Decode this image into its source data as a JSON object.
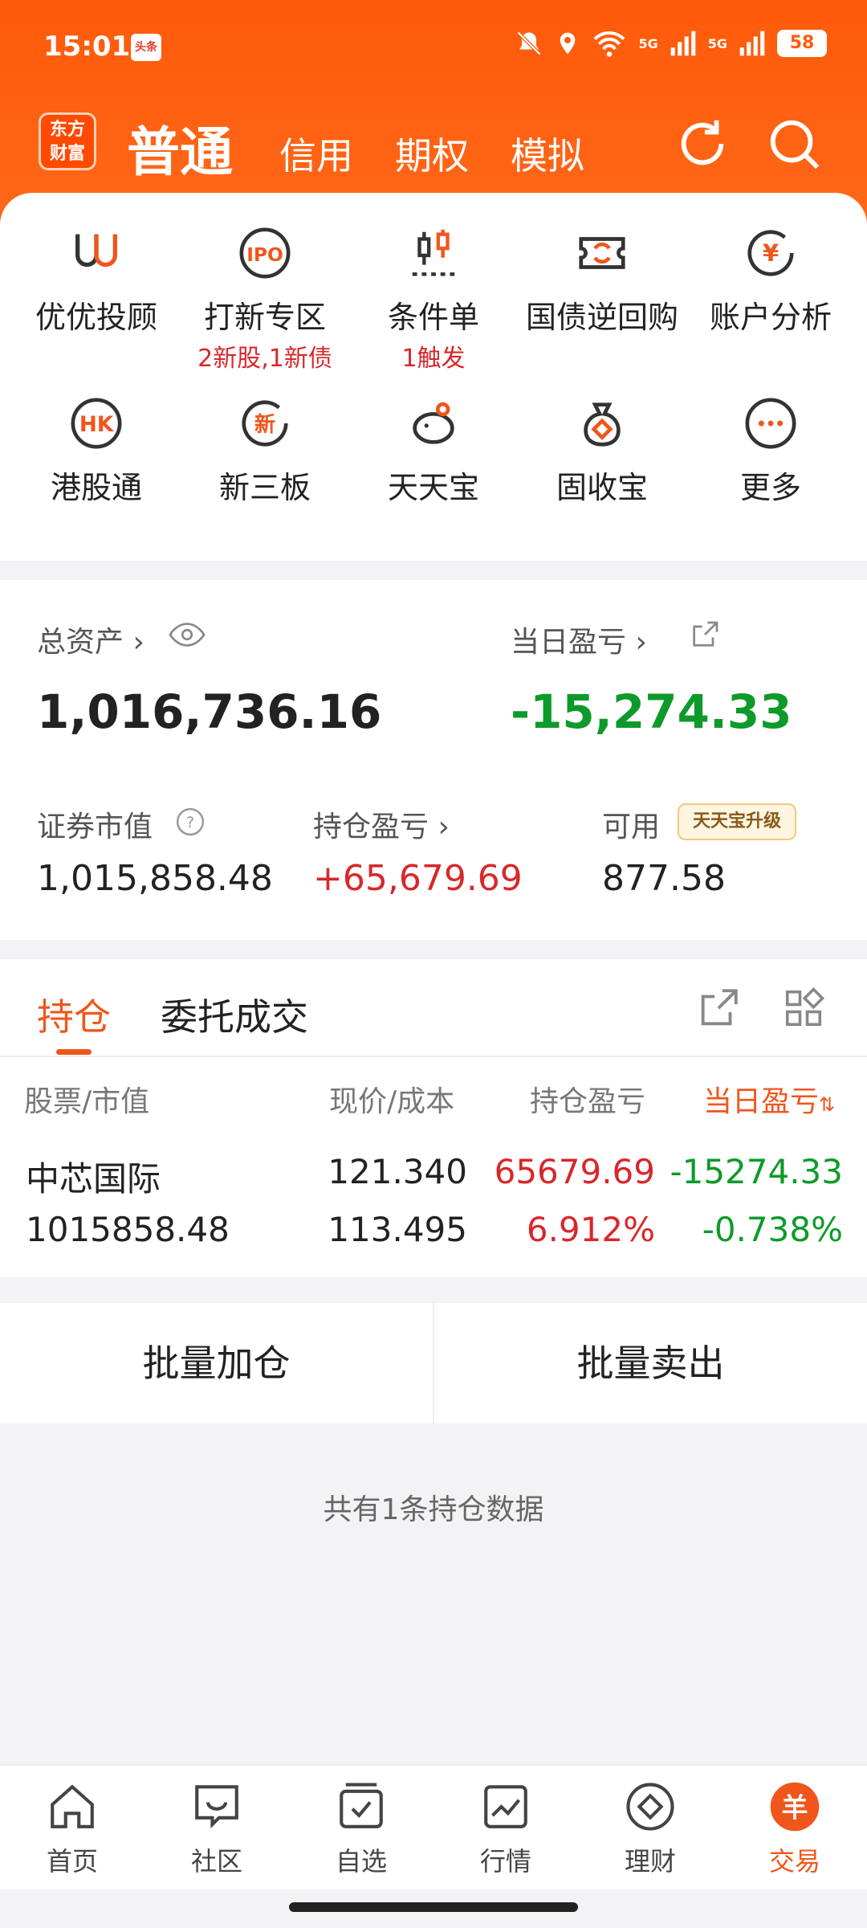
{
  "status_bar": {
    "time": "15:01",
    "news_badge": "头条",
    "signal1": "5G",
    "signal2": "5G",
    "battery": "58"
  },
  "top_nav": {
    "logo_line1": "东方",
    "logo_line2": "财富",
    "tabs": [
      {
        "label": "普通"
      },
      {
        "label": "信用"
      },
      {
        "label": "期权"
      },
      {
        "label": "模拟"
      }
    ]
  },
  "quick_menu": [
    {
      "label": "优优投顾",
      "sub": ""
    },
    {
      "label": "打新专区",
      "sub": "2新股,1新债",
      "icon_text": "IPO"
    },
    {
      "label": "条件单",
      "sub": "1触发"
    },
    {
      "label": "国债逆回购",
      "sub": ""
    },
    {
      "label": "账户分析",
      "sub": "",
      "icon_text": "¥"
    },
    {
      "label": "港股通",
      "sub": "",
      "icon_text": "HK"
    },
    {
      "label": "新三板",
      "sub": "",
      "icon_text": "新"
    },
    {
      "label": "天天宝",
      "sub": ""
    },
    {
      "label": "固收宝",
      "sub": ""
    },
    {
      "label": "更多",
      "sub": ""
    }
  ],
  "assets": {
    "total_label": "总资产",
    "total_value": "1,016,736.16",
    "daily_pl_label": "当日盈亏",
    "daily_pl_value": "-15,274.33",
    "market_value_label": "证券市值",
    "market_value": "1,015,858.48",
    "position_pl_label": "持仓盈亏",
    "position_pl_value": "+65,679.69",
    "available_label": "可用",
    "available_value": "877.58",
    "upgrade_badge": "天天宝升级"
  },
  "positions": {
    "tabs": [
      {
        "label": "持仓"
      },
      {
        "label": "委托成交"
      }
    ],
    "columns": [
      "股票/市值",
      "现价/成本",
      "持仓盈亏",
      "当日盈亏"
    ],
    "rows": [
      {
        "name": "中芯国际",
        "market_value": "1015858.48",
        "price": "121.340",
        "cost": "113.495",
        "pl": "65679.69",
        "pl_pct": "6.912%",
        "daily_pl": "-15274.33",
        "daily_pct": "-0.738%"
      }
    ]
  },
  "actions": {
    "batch_add": "批量加仓",
    "batch_sell": "批量卖出"
  },
  "summary": "共有1条持仓数据",
  "bottom_nav": [
    {
      "label": "首页"
    },
    {
      "label": "社区"
    },
    {
      "label": "自选"
    },
    {
      "label": "行情"
    },
    {
      "label": "理财"
    },
    {
      "label": "交易",
      "icon_text": "羊"
    }
  ],
  "colors": {
    "brand": "#ff5a0a",
    "up": "#d8272b",
    "down": "#0e9a2a"
  }
}
